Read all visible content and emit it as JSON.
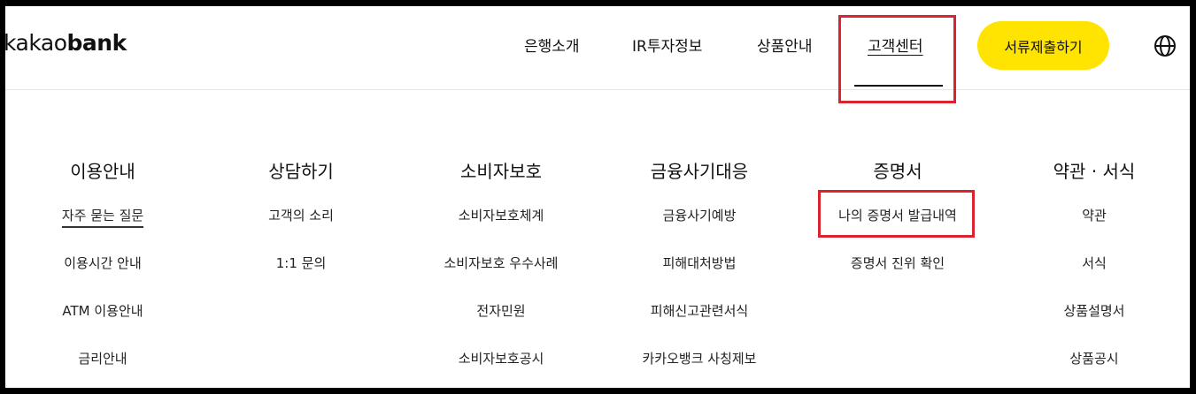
{
  "logo": {
    "light": "kakao",
    "bold": "bank"
  },
  "nav": {
    "items": [
      {
        "label": "은행소개"
      },
      {
        "label": "IR투자정보"
      },
      {
        "label": "상품안내"
      },
      {
        "label": "고객센터",
        "active": true
      }
    ],
    "cta_label": "서류제출하기",
    "globe_icon": "globe-icon"
  },
  "colors": {
    "accent_yellow": "#fee400",
    "highlight_red": "#d9232e",
    "text": "#111111"
  },
  "menu": {
    "columns": [
      {
        "title": "이용안내",
        "items": [
          "자주 묻는 질문",
          "이용시간 안내",
          "ATM 이용안내",
          "금리안내"
        ]
      },
      {
        "title": "상담하기",
        "items": [
          "고객의 소리",
          "1:1 문의"
        ]
      },
      {
        "title": "소비자보호",
        "items": [
          "소비자보호체계",
          "소비자보호 우수사례",
          "전자민원",
          "소비자보호공시"
        ]
      },
      {
        "title": "금융사기대응",
        "items": [
          "금융사기예방",
          "피해대처방법",
          "피해신고관련서식",
          "카카오뱅크 사칭제보"
        ]
      },
      {
        "title": "증명서",
        "items": [
          "나의 증명서 발급내역",
          "증명서 진위 확인"
        ]
      },
      {
        "title": "약관 · 서식",
        "items": [
          "약관",
          "서식",
          "상품설명서",
          "상품공시"
        ]
      }
    ]
  }
}
